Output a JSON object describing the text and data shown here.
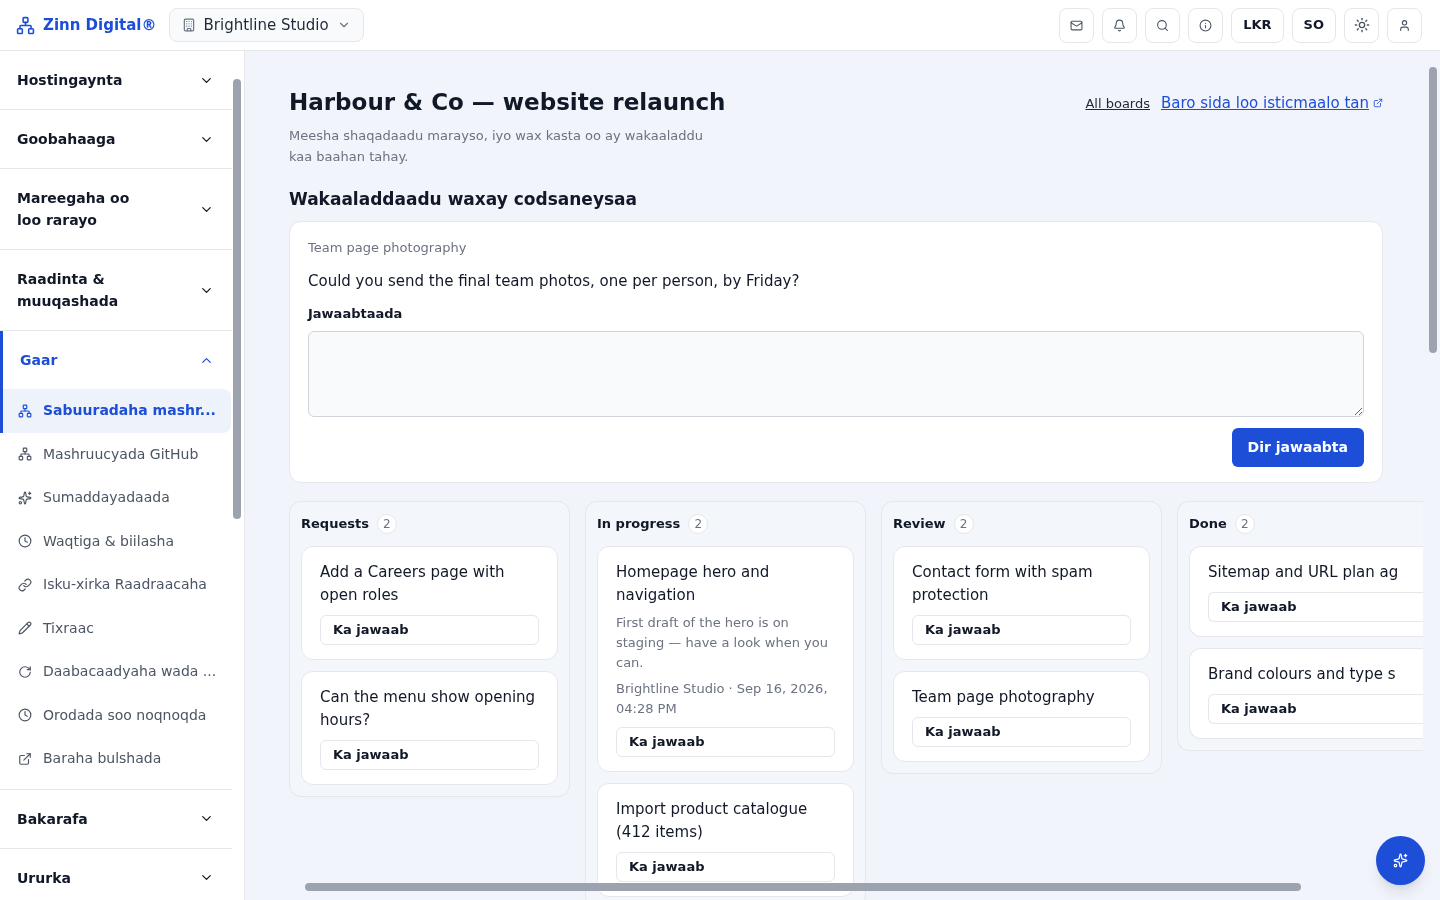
{
  "header": {
    "brand": "Zinn Digital®",
    "workspace": "Brightline Studio",
    "buttons": [
      "LKR",
      "SO"
    ]
  },
  "sidebar": {
    "sections": [
      {
        "label": "Hostingaynta",
        "expanded": false
      },
      {
        "label": "Goobahaaga",
        "expanded": false
      },
      {
        "label": "Mareegaha oo loo rarayo",
        "expanded": false
      },
      {
        "label": "Raadinta & muuqashada",
        "expanded": false
      },
      {
        "label": "Gaar",
        "expanded": true,
        "items": [
          {
            "label": "Sabuuradaha mashr...",
            "selected": true
          },
          {
            "label": "Mashruucyada GitHub",
            "selected": false
          },
          {
            "label": "Sumaddayadaada",
            "selected": false
          },
          {
            "label": "Waqtiga & biilasha",
            "selected": false
          },
          {
            "label": "Isku-xirka Raadraacaha",
            "selected": false
          },
          {
            "label": "Tixraac",
            "selected": false
          },
          {
            "label": "Daabacaadyaha wada ...",
            "selected": false
          },
          {
            "label": "Orodada soo noqnoqda",
            "selected": false
          },
          {
            "label": "Baraha bulshada",
            "selected": false
          }
        ]
      },
      {
        "label": "Bakarafa",
        "expanded": false
      },
      {
        "label": "Ururka",
        "expanded": false
      }
    ]
  },
  "page": {
    "title": "Harbour & Co — website relaunch",
    "subtitle": "Meesha shaqadaadu marayso, iyo wax kasta oo ay wakaaladdu kaa baahan tahay.",
    "links": [
      "All boards",
      "Baro sida loo isticmaalo tan"
    ]
  },
  "request": {
    "heading": "Wakaaladdaadu waxay codsaneysaa",
    "topic": "Team page photography",
    "question": "Could you send the final team photos, one per person, by Friday?",
    "answer_label": "Jawaabtaada",
    "submit": "Dir jawaabta"
  },
  "board": {
    "columns": [
      {
        "title": "Requests",
        "count": "2",
        "cards": [
          {
            "title": "Add a Careers page with open roles",
            "action": "Ka jawaab"
          },
          {
            "title": "Can the menu show opening hours?",
            "action": "Ka jawaab"
          }
        ]
      },
      {
        "title": "In progress",
        "count": "2",
        "cards": [
          {
            "title": "Homepage hero and navigation",
            "body": "First draft of the hero is on staging — have a look when you can.",
            "meta": "Brightline Studio · Sep 16, 2026, 04:28 PM",
            "action": "Ka jawaab"
          },
          {
            "title": "Import product catalogue (412 items)",
            "action": "Ka jawaab"
          }
        ]
      },
      {
        "title": "Review",
        "count": "2",
        "cards": [
          {
            "title": "Contact form with spam protection",
            "action": "Ka jawaab"
          },
          {
            "title": "Team page photography",
            "action": "Ka jawaab"
          }
        ]
      },
      {
        "title": "Done",
        "count": "2",
        "cards": [
          {
            "title": "Sitemap and URL plan ag",
            "action": "Ka jawaab"
          },
          {
            "title": "Brand colours and type s",
            "action": "Ka jawaab"
          }
        ]
      }
    ]
  }
}
